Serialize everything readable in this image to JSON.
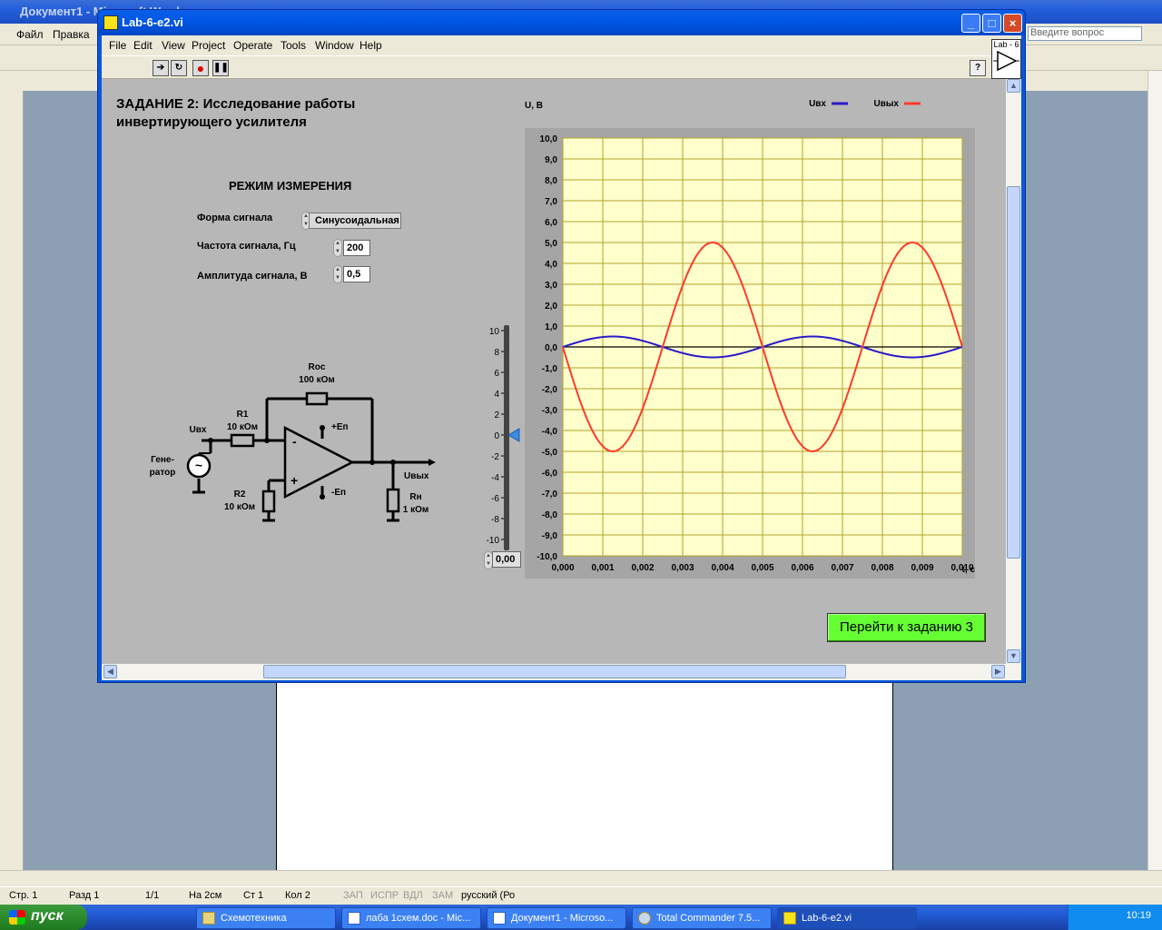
{
  "word": {
    "title": "Документ1 - Microsoft Word",
    "menu": [
      "Файл",
      "Правка"
    ],
    "help_placeholder": "Введите вопрос",
    "status": {
      "page": "Стр. 1",
      "section": "Разд 1",
      "pages": "1/1",
      "at": "На 2см",
      "line": "Ст 1",
      "col": "Кол 2",
      "rec": "ЗАП",
      "trk": "ИСПР",
      "ext": "ВДЛ",
      "ovr": "ЗАМ",
      "lang": "русский (Ро"
    }
  },
  "taskbar": {
    "start": "пуск",
    "buttons": [
      {
        "label": "Схемотехника"
      },
      {
        "label": "лаба 1схем.doc - Mic..."
      },
      {
        "label": "Документ1 - Microso..."
      },
      {
        "label": "Total Commander 7.5..."
      },
      {
        "label": "Lab-6-e2.vi"
      }
    ],
    "clock": "10:19"
  },
  "labview": {
    "title": "Lab-6-e2.vi",
    "menu": [
      "File",
      "Edit",
      "View",
      "Project",
      "Operate",
      "Tools",
      "Window",
      "Help"
    ],
    "logo_text": "Lab - 6",
    "task_title_line1": "ЗАДАНИЕ 2: Исследование работы",
    "task_title_line2": "инвертирующего усилителя",
    "mode_title": "РЕЖИМ ИЗМЕРЕНИЯ",
    "waveform_label": "Форма сигнала",
    "waveform_value": "Синусоидальная",
    "freq_label": "Частота сигнала, Гц",
    "freq_value": "200",
    "amp_label": "Амплитуда сигнала, В",
    "amp_value": "0,5",
    "next_button": "Перейти к заданию 3",
    "slider_value": "0,00",
    "circuit": {
      "roc_name": "Roc",
      "roc_value": "100 кОм",
      "r1_name": "R1",
      "r1_value": "10 кОм",
      "r2_name": "R2",
      "r2_value": "10 кОм",
      "rn_name": "Rн",
      "rn_value": "1 кОм",
      "uin": "Uвх",
      "uout": "Uвых",
      "gen_line1": "Гене-",
      "gen_line2": "ратор",
      "vplus": "+Еп",
      "vminus": "-Еп",
      "minus": "-",
      "plus": "+",
      "tilde": "~"
    }
  },
  "chart_data": {
    "type": "line",
    "ylabel": "U, В",
    "xlabel": "t, с",
    "xlim": [
      0,
      0.01
    ],
    "ylim": [
      -10,
      10
    ],
    "x_ticks": [
      "0,000",
      "0,001",
      "0,002",
      "0,003",
      "0,004",
      "0,005",
      "0,006",
      "0,007",
      "0,008",
      "0,009",
      "0,010"
    ],
    "y_ticks": [
      "10,0",
      "9,0",
      "8,0",
      "7,0",
      "6,0",
      "5,0",
      "4,0",
      "3,0",
      "2,0",
      "1,0",
      "0,0",
      "-1,0",
      "-2,0",
      "-3,0",
      "-4,0",
      "-5,0",
      "-6,0",
      "-7,0",
      "-8,0",
      "-9,0",
      "-10,0"
    ],
    "grid": true,
    "legend_position": "top-right",
    "series": [
      {
        "name": "Uвх",
        "color": "#2a1ac8",
        "amplitude": 0.5,
        "frequency_hz": 200,
        "phase": "sin"
      },
      {
        "name": "Uвых",
        "color": "#ff3a2a",
        "amplitude": 5.0,
        "frequency_hz": 200,
        "phase": "-sin"
      }
    ],
    "slider_ticks": [
      "10",
      "8",
      "6",
      "4",
      "2",
      "0",
      "-2",
      "-4",
      "-6",
      "-8",
      "-10"
    ],
    "slider_value": 0
  },
  "colors": {
    "plot_bg": "#ffffcc",
    "grid": "#b3a329",
    "panel": "#b7b7b7",
    "button_green": "#66ff33"
  }
}
